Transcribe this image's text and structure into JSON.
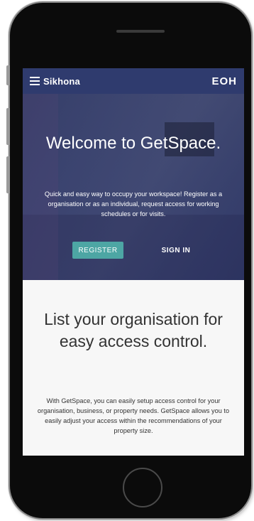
{
  "app": {
    "brand": "Sikhona",
    "logo": "EOH",
    "menu_icon": "hamburger-menu-icon"
  },
  "hero": {
    "title": "Welcome to GetSpace.",
    "description": "Quick and easy way to occupy your workspace! Register as a organisation or as an individual, request access for working schedules or for visits.",
    "register_label": "REGISTER",
    "signin_label": "SIGN IN"
  },
  "section": {
    "title": "List your organisation for easy access control.",
    "text": "With GetSpace, you can easily setup access control for your organisation, business, or property needs. GetSpace allows you to easily adjust your access within the recommendations of your property size."
  },
  "colors": {
    "topbar": "#2f3b6e",
    "accent": "#4da6a4",
    "hero_overlay": "#263060"
  }
}
